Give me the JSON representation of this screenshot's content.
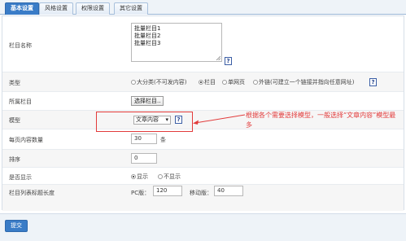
{
  "tabs": [
    {
      "label": "基本设置"
    },
    {
      "label": "风格设置"
    },
    {
      "label": "权限设置"
    },
    {
      "label": "其它设置"
    }
  ],
  "fields": {
    "name": {
      "label": "栏目名称",
      "lines": [
        "批量栏目1",
        "批量栏目2",
        "批量栏目3"
      ]
    },
    "type": {
      "label": "类型",
      "options": [
        "大分类(不可发内容)",
        "栏目",
        "单网页",
        "外链(可建立一个链接并指向任意网址)"
      ]
    },
    "parent": {
      "label": "所属栏目",
      "button": "选择栏目.."
    },
    "model": {
      "label": "模型",
      "selected": "文章内容"
    },
    "per_page": {
      "label": "每页内容数量",
      "value": "30",
      "unit": "条"
    },
    "order": {
      "label": "排序",
      "value": "0"
    },
    "visible": {
      "label": "是否显示",
      "options": [
        "显示",
        "不显示"
      ]
    },
    "title_length": {
      "label": "栏目列表标题长度",
      "pc_label": "PC版：",
      "pc_value": "120",
      "mobile_label": "移动版：",
      "mobile_value": "40"
    }
  },
  "help_icon": "?",
  "annotation": {
    "text": "根据各个需要选择模型，一般选择“文章内容”模型最多"
  },
  "submit": "提交",
  "colors": {
    "accent": "#3a7cc7",
    "annotation": "#e23b3b"
  }
}
